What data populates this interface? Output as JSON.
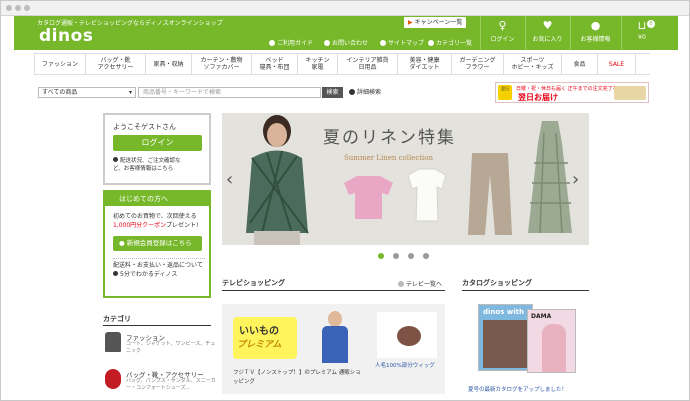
{
  "header": {
    "tagline": "カタログ通販・テレビショッピングならディノスオンラインショップ",
    "logo": "dinos",
    "campaign_label": "キャンペーン一覧",
    "subnav": [
      "ご利用ガイド",
      "お問い合わせ",
      "サイトマップ",
      "カテゴリ一覧"
    ],
    "buttons": {
      "login": "ログイン",
      "favorites": "お気に入り",
      "account": "お客様情報",
      "cart_total": "¥0",
      "cart_count": "0"
    }
  },
  "category_nav": [
    "ファッション",
    "バッグ・靴\nアクセサリー",
    "家具・収納",
    "カーテン・敷物\nソファカバー",
    "ベッド\n寝具・布団",
    "キッチン\n家電",
    "インテリア雑貨\n日用品",
    "美容・健康\nダイエット",
    "ガーデニング\nフラワー",
    "スポーツ\nホビー・キッズ",
    "食品",
    "SALE"
  ],
  "search": {
    "scope": "すべての商品",
    "placeholder": "商品番号・キーワードで検索",
    "button": "検索",
    "advanced": "詳細検索"
  },
  "ship_banner": {
    "tag": "翌日",
    "line1": "日曜・祝・休日も届く 正午までの注文完了なら",
    "line2": "翌日お届け"
  },
  "welcome": {
    "greeting": "ようこそゲストさん",
    "login_button": "ログイン",
    "note_line1": "配送状況、ご注文確認な",
    "note_line2": "ど、お客様情報はこちら"
  },
  "first_time": {
    "heading": "はじめての方へ",
    "promo_line1": "初めてのお買物で、次回使える",
    "promo_coupon": "1,000円分クーポン",
    "promo_suffix": "プレゼント!",
    "register_button": "新規会員登録はこちら",
    "info_line1": "配送料・お支払い・返品について",
    "info_line2": "5分でわかるディノス"
  },
  "categories": {
    "heading": "カテゴリ",
    "items": [
      {
        "name": "ファッション",
        "sub": "コート、ジャケット、ワンピース、チュニック"
      },
      {
        "name": "バッグ・靴・アクセサリー",
        "sub": "バッグ、パンプス・サンダル、スニーカー・コンフォートシューズ…"
      }
    ]
  },
  "hero": {
    "title": "夏のリネン特集",
    "subtitle": "Summer Linen collection",
    "slide_count": 4,
    "active_slide": 1
  },
  "tv": {
    "heading": "テレビショッピング",
    "more": "テレビ一覧へ",
    "premium_word1": "いいもの",
    "premium_word2": "プレミアム",
    "caption1": "フジＴＶ【ノンストップ！】のプレミアム 通販ショッピング",
    "caption2": "人毛100%部分ウィッグ"
  },
  "catalog": {
    "heading": "カタログショッピング",
    "mag1_title": "dinos with",
    "mag2_title": "DAMA",
    "caption": "夏号の最新カタログをアップしました！"
  },
  "colors": {
    "brand_green": "#76b82a",
    "sale_red": "#e60012",
    "hero_bg": "#e4e2dd"
  }
}
